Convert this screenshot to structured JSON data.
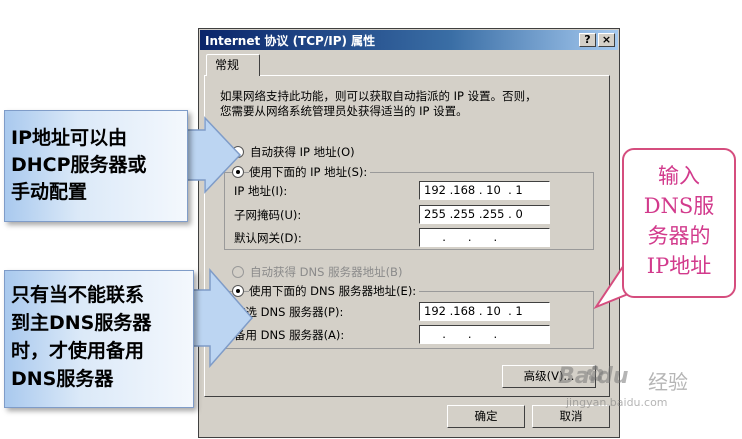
{
  "window": {
    "title": "Internet 协议 (TCP/IP) 属性",
    "help_button": "?",
    "close_button": "×"
  },
  "tab": {
    "label": "常规"
  },
  "description": [
    "如果网络支持此功能，则可以获取自动指派的 IP 设置。否则，",
    "您需要从网络系统管理员处获得适当的 IP 设置。"
  ],
  "ip_section": {
    "auto_option": "自动获得 IP 地址(O)",
    "manual_option": "使用下面的 IP 地址(S):",
    "fields": [
      {
        "label": "IP 地址(I):",
        "value": "192 .168 . 10  . 1"
      },
      {
        "label": "子网掩码(U):",
        "value": "255 .255 .255 . 0"
      },
      {
        "label": "默认网关(D):",
        "value": "     .      .      ."
      }
    ]
  },
  "dns_section": {
    "auto_option": "自动获得 DNS 服务器地址(B)",
    "manual_option": "使用下面的 DNS 服务器地址(E):",
    "fields": [
      {
        "label": "首选 DNS 服务器(P):",
        "value": "192 .168 . 10  . 1"
      },
      {
        "label": "备用 DNS 服务器(A):",
        "value": "     .      .      ."
      }
    ]
  },
  "buttons": {
    "advanced": "高级(V)...",
    "ok": "确定",
    "cancel": "取消"
  },
  "callouts": {
    "top_left": [
      "IP地址可以由",
      "DHCP服务器或",
      "手动配置"
    ],
    "bottom_left": [
      "只有当不能联系",
      "到主DNS服务器",
      "时，才使用备用",
      "DNS服务器"
    ],
    "right": [
      "输入",
      "DNS服",
      "务器的",
      "IP地址"
    ]
  },
  "watermark": {
    "brand": "Baidu",
    "sub": "经验",
    "url": "jingyan.baidu.com"
  },
  "colors": {
    "title_bar": "#0a246a",
    "dialog_face": "#d4d0c8",
    "callout_blue": "#a9c9ee",
    "callout_pink": "#d23a8c"
  }
}
